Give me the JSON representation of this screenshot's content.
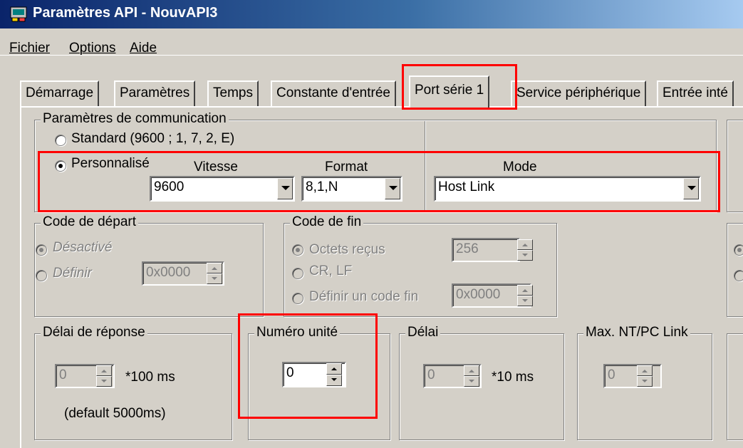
{
  "window": {
    "title": "Paramètres API - NouvAPI3",
    "icon": "plc-icon"
  },
  "menu": {
    "items": [
      "Fichier",
      "Options",
      "Aide"
    ]
  },
  "tabs": [
    "Démarrage",
    "Paramètres",
    "Temps",
    "Constante d'entrée",
    "Port série 1",
    "Service périphérique",
    "Entrée inté"
  ],
  "selected_tab": "Port série 1",
  "comm": {
    "legend": "Paramètres de communication",
    "standard_label": "Standard (9600 ; 1, 7, 2, E)",
    "custom_label": "Personnalisé",
    "selected": "Personnalisé",
    "vitesse_label": "Vitesse",
    "vitesse_value": "9600",
    "format_label": "Format",
    "format_value": "8,1,N",
    "mode_label": "Mode",
    "mode_value": "Host Link"
  },
  "start_code": {
    "legend": "Code de départ",
    "opt_disabled": "Désactivé",
    "opt_define": "Définir",
    "value": "0x0000",
    "selected": "Désactivé"
  },
  "end_code": {
    "legend": "Code de fin",
    "opt_bytes": "Octets reçus",
    "bytes_value": "256",
    "opt_crlf": "CR, LF",
    "opt_define": "Définir un code fin",
    "code_value": "0x0000",
    "selected": "Octets reçus"
  },
  "response_delay": {
    "legend": "Délai de réponse",
    "value": "0",
    "unit": "*100 ms",
    "note": "(default 5000ms)"
  },
  "unit_number": {
    "legend": "Numéro unité",
    "value": "0"
  },
  "delay": {
    "legend": "Délai",
    "value": "0",
    "unit": "*10 ms"
  },
  "max_nt": {
    "legend": "Max. NT/PC Link",
    "value": "0"
  },
  "highlight_color": "#ff0000"
}
